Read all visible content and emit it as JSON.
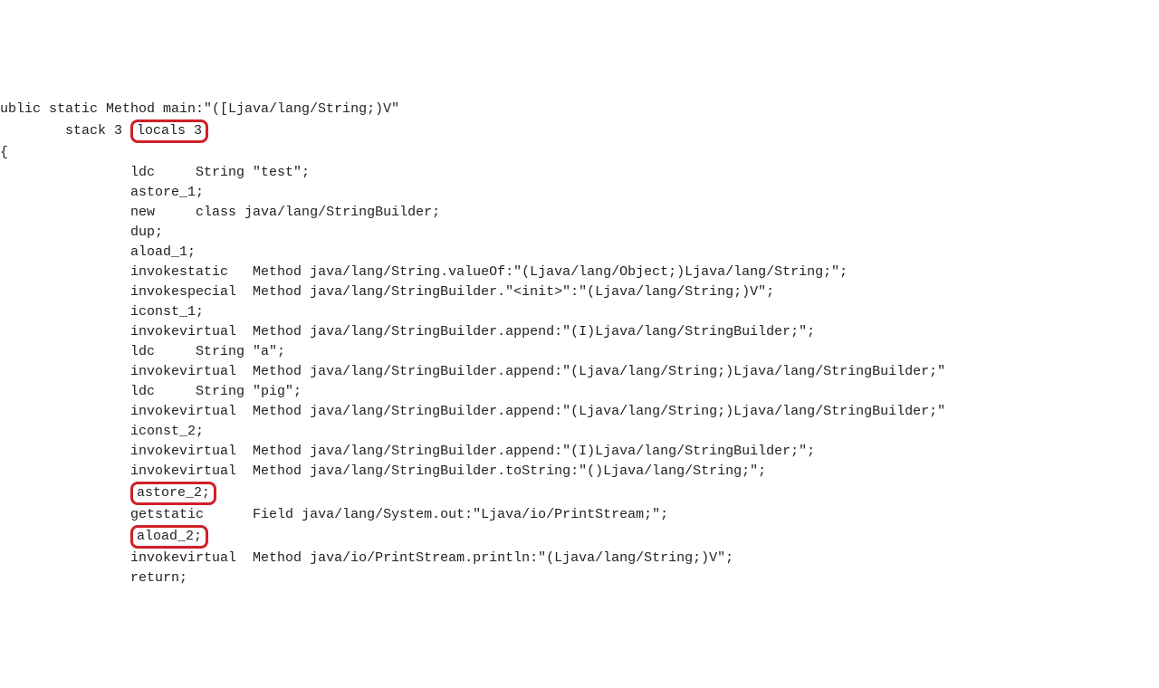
{
  "header": {
    "sig_prefix": "ublic static Method main:\"([Ljava/lang/String;)V\"",
    "stack_prefix": "        stack 3 ",
    "locals": "locals 3"
  },
  "brace": "{",
  "indent": "                ",
  "lines": {
    "l1": "ldc     String \"test\";",
    "l2": "astore_1;",
    "l3": "new     class java/lang/StringBuilder;",
    "l4": "dup;",
    "l5": "aload_1;",
    "l6": "invokestatic   Method java/lang/String.valueOf:\"(Ljava/lang/Object;)Ljava/lang/String;\";",
    "l7": "invokespecial  Method java/lang/StringBuilder.\"<init>\":\"(Ljava/lang/String;)V\";",
    "l8": "iconst_1;",
    "l9": "invokevirtual  Method java/lang/StringBuilder.append:\"(I)Ljava/lang/StringBuilder;\";",
    "l10": "ldc     String \"a\";",
    "l11": "invokevirtual  Method java/lang/StringBuilder.append:\"(Ljava/lang/String;)Ljava/lang/StringBuilder;\"",
    "l12": "ldc     String \"pig\";",
    "l13": "invokevirtual  Method java/lang/StringBuilder.append:\"(Ljava/lang/String;)Ljava/lang/StringBuilder;\"",
    "l14": "iconst_2;",
    "l15": "invokevirtual  Method java/lang/StringBuilder.append:\"(I)Ljava/lang/StringBuilder;\";",
    "l16": "invokevirtual  Method java/lang/StringBuilder.toString:\"()Ljava/lang/String;\";",
    "l17": "astore_2;",
    "l18": "getstatic      Field java/lang/System.out:\"Ljava/io/PrintStream;\";",
    "l19": "aload_2;",
    "l20": "invokevirtual  Method java/io/PrintStream.println:\"(Ljava/lang/String;)V\";",
    "l21": "return;"
  }
}
